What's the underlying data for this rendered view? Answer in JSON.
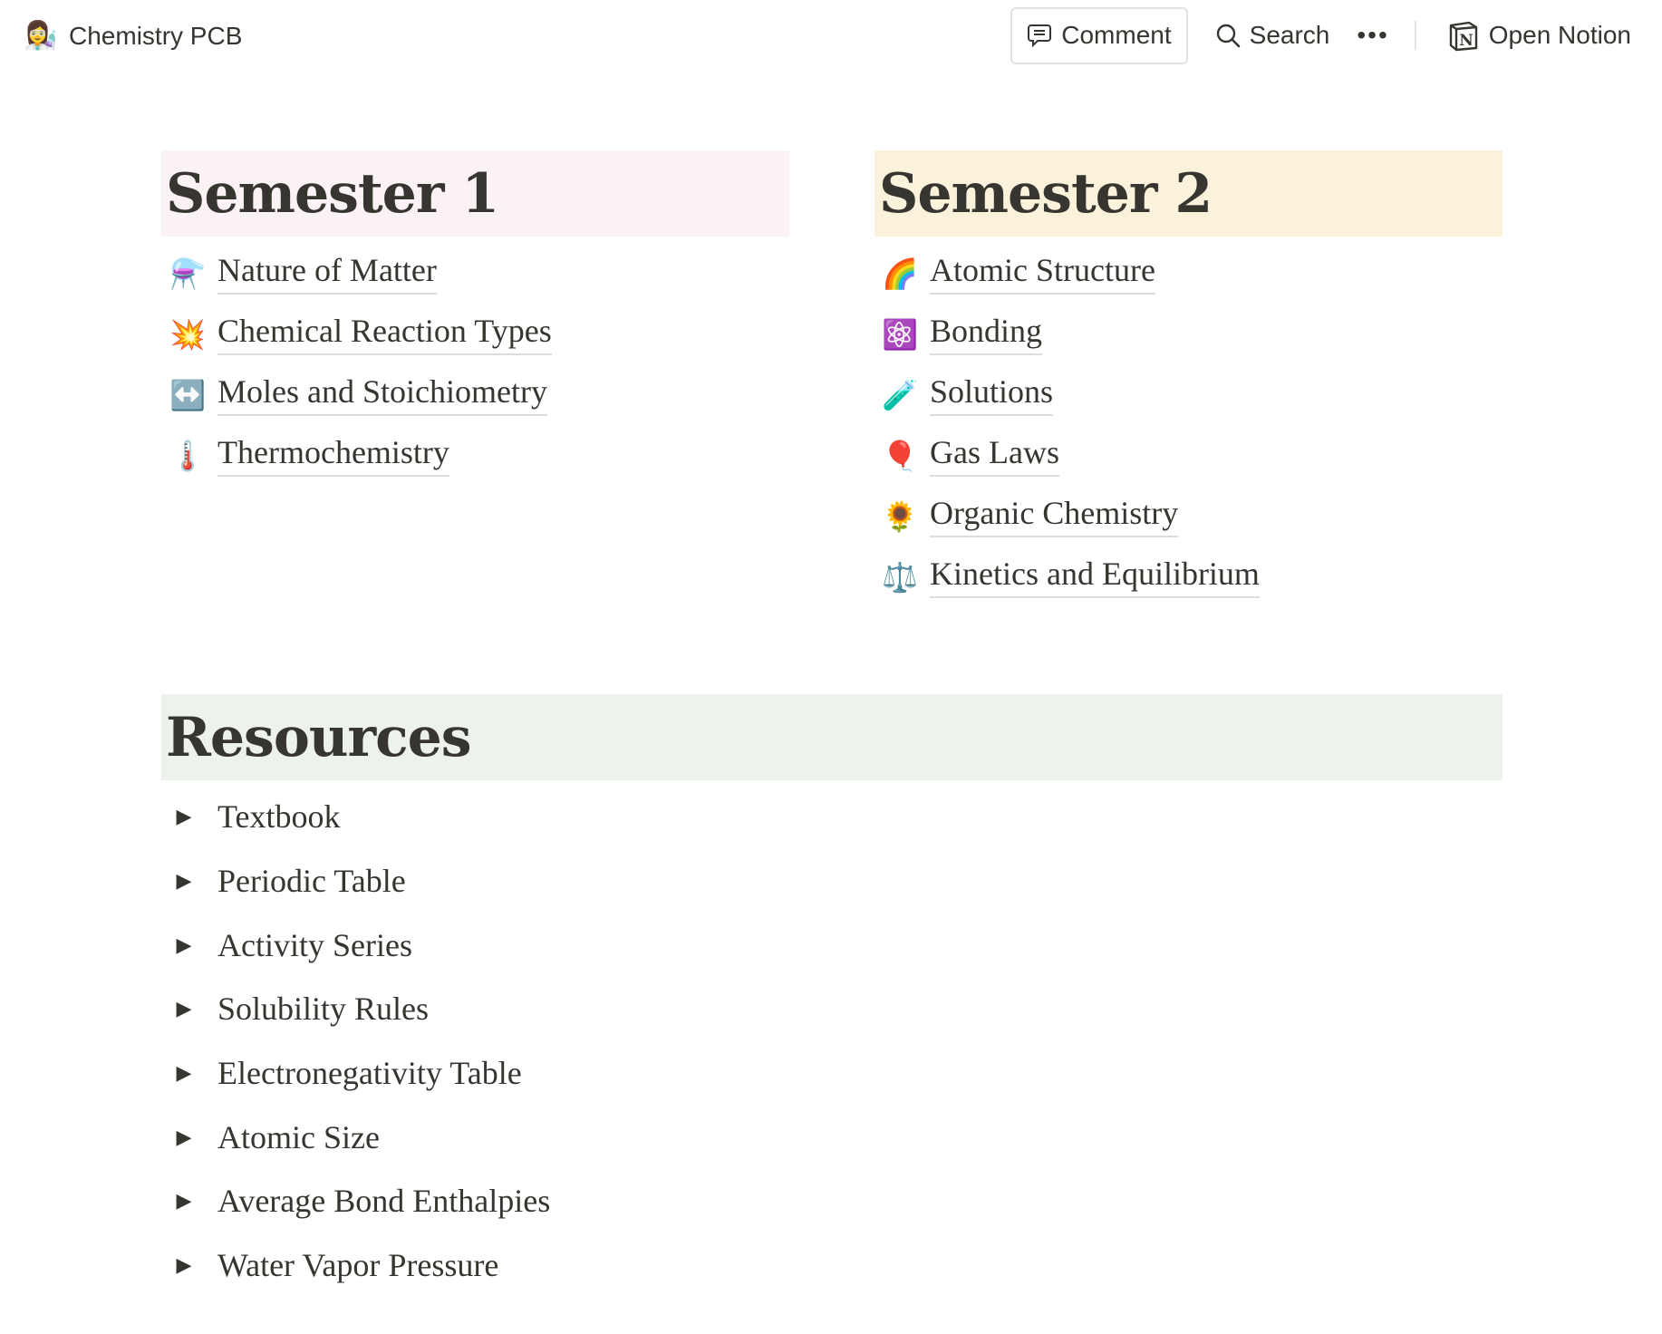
{
  "topbar": {
    "page_emoji": "👩‍🔬",
    "page_title": "Chemistry PCB",
    "comment_label": "Comment",
    "search_label": "Search",
    "more_label": "•••",
    "open_notion_label": "Open Notion"
  },
  "semester1": {
    "title": "Semester 1",
    "bg_color": "#fbf2f5",
    "items": [
      {
        "emoji": "⚗️",
        "icon": "alembic-icon",
        "label": "Nature of Matter"
      },
      {
        "emoji": "💥",
        "icon": "collision-icon",
        "label": "Chemical Reaction Types"
      },
      {
        "emoji": "↔️",
        "icon": "left-right-arrow-icon",
        "label": "Moles and Stoichiometry"
      },
      {
        "emoji": "🌡️",
        "icon": "thermometer-icon",
        "label": "Thermochemistry"
      }
    ]
  },
  "semester2": {
    "title": "Semester 2",
    "bg_color": "#fbf2dc",
    "items": [
      {
        "emoji": "🌈",
        "icon": "rainbow-icon",
        "label": "Atomic Structure"
      },
      {
        "emoji": "⚛️",
        "icon": "atom-icon",
        "label": "Bonding"
      },
      {
        "emoji": "🧪",
        "icon": "test-tube-icon",
        "label": "Solutions"
      },
      {
        "emoji": "🎈",
        "icon": "balloon-icon",
        "label": "Gas Laws"
      },
      {
        "emoji": "🌻",
        "icon": "sunflower-icon",
        "label": "Organic Chemistry"
      },
      {
        "emoji": "⚖️",
        "icon": "balance-scale-icon",
        "label": "Kinetics and Equilibrium"
      }
    ]
  },
  "resources": {
    "title": "Resources",
    "bg_color": "#edf3ec",
    "toggle_glyph": "▶",
    "items": [
      "Textbook",
      "Periodic Table",
      "Activity Series",
      "Solubility Rules",
      "Electronegativity Table",
      "Atomic Size",
      "Average Bond Enthalpies",
      "Water Vapor Pressure"
    ]
  }
}
